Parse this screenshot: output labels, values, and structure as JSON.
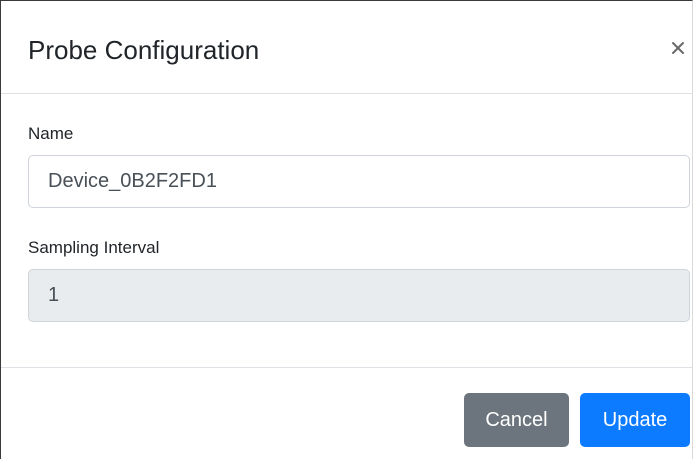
{
  "dialog": {
    "title": "Probe Configuration",
    "close_icon": "close-icon"
  },
  "form": {
    "name": {
      "label": "Name",
      "value": "Device_0B2F2FD1"
    },
    "sampling_interval": {
      "label": "Sampling Interval",
      "value": "1",
      "readonly": true
    }
  },
  "footer": {
    "cancel_label": "Cancel",
    "update_label": "Update"
  },
  "colors": {
    "cancel_bg": "#6c757d",
    "update_bg": "#0d7bff",
    "readonly_bg": "#e9ecef",
    "border": "#dee2e6"
  }
}
